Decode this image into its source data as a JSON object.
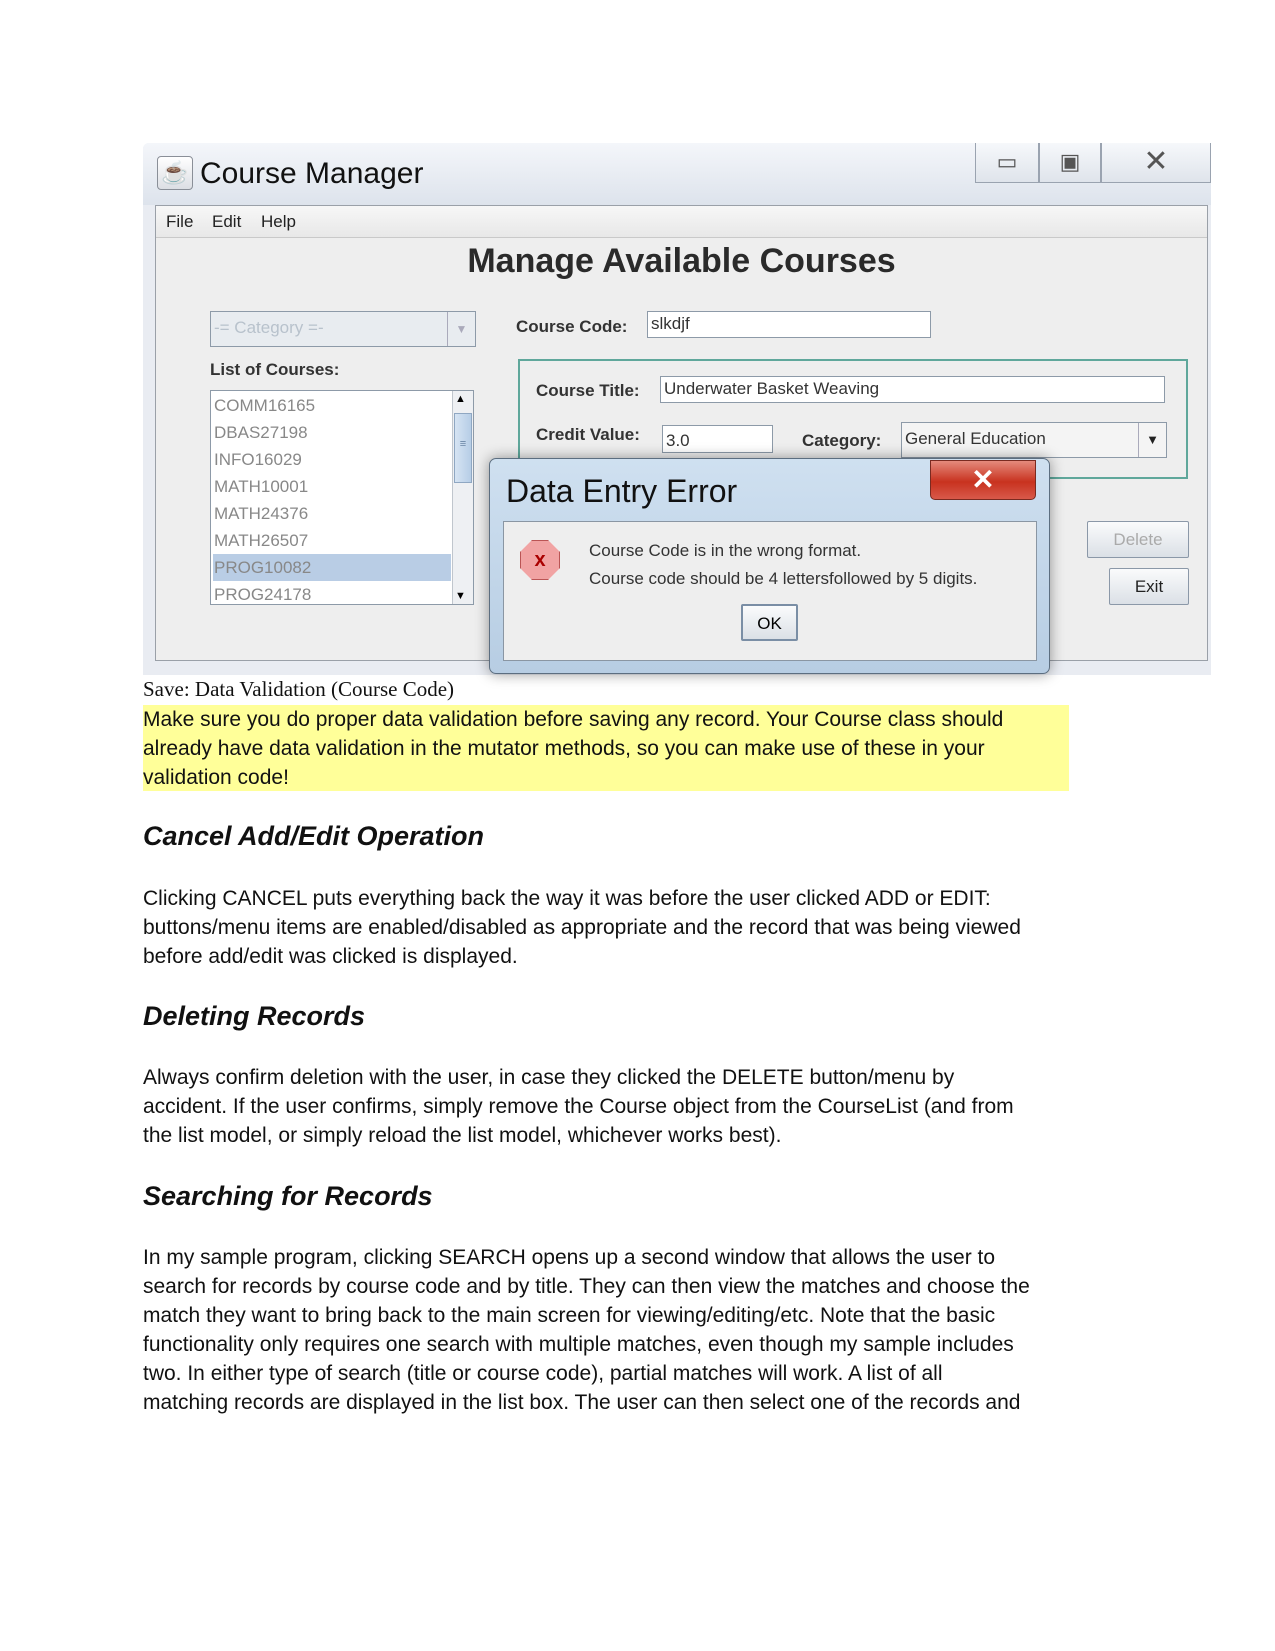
{
  "screenshot": {
    "window_title": "Course Manager",
    "menu": [
      "File",
      "Edit",
      "Help"
    ],
    "heading": "Manage Available Courses",
    "category_filter_placeholder": "-= Category =-",
    "list_label": "List of Courses:",
    "courses": [
      "COMM16165",
      "DBAS27198",
      "INFO16029",
      "MATH10001",
      "MATH24376",
      "MATH26507",
      "PROG10082",
      "PROG24178"
    ],
    "selected_course": "PROG10082",
    "course_code_label": "Course Code:",
    "course_code_value": "slkdjf",
    "course_title_label": "Course Title:",
    "course_title_value": "Underwater Basket Weaving",
    "credit_value_label": "Credit Value:",
    "credit_value": "3.0",
    "category_label": "Category:",
    "category_value": "General Education",
    "delete_label": "Delete",
    "exit_label": "Exit",
    "dialog": {
      "title": "Data Entry Error",
      "message_1": "Course Code is in the wrong format.",
      "message_2": "Course code should be 4 lettersfollowed by 5 digits.",
      "ok_label": "OK"
    }
  },
  "caption": "Save: Data Validation (Course Code)",
  "highlight_lines": [
    "Make sure you do proper data validation before saving any record. Your Course class should",
    "already have data validation in the mutator methods, so you can make use of these in your",
    "validation code!"
  ],
  "highlight_color": "#ffff99",
  "sections": [
    {
      "heading": "Cancel Add/Edit Operation",
      "lines": [
        "Clicking CANCEL puts everything back the way it was before the user clicked ADD or EDIT:",
        "buttons/menu items are enabled/disabled as appropriate and the record that was being viewed",
        "before add/edit was clicked is displayed."
      ]
    },
    {
      "heading": "Deleting Records",
      "lines": [
        "Always confirm deletion with the user, in case they clicked the DELETE button/menu by",
        "accident. If the user confirms, simply remove the Course object from the CourseList (and from",
        "the list model, or simply reload the list model, whichever works best)."
      ]
    },
    {
      "heading": "Searching for Records",
      "lines": [
        "In my sample program, clicking SEARCH opens up a second window that allows the user to",
        "search for records by course code and by title. They can then view the matches and choose the",
        "match they want to bring back to the main screen for viewing/editing/etc. Note that the basic",
        "functionality only requires one search with multiple matches, even though my sample includes",
        "two. In either type of search (title or course code), partial matches will work. A list of all",
        "matching records are displayed in the list box. The user can then select one of the records and"
      ]
    }
  ]
}
